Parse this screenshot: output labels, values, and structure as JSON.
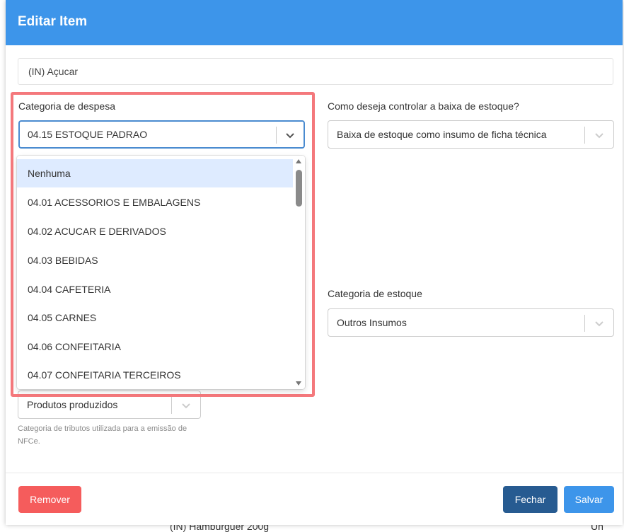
{
  "modal": {
    "title": "Editar Item",
    "item_name": "(IN) Açucar"
  },
  "expense_category": {
    "label": "Categoria de despesa",
    "selected": "04.15 ESTOQUE PADRAO",
    "options": [
      "Nenhuma",
      "04.01 ACESSORIOS E EMBALAGENS",
      "04.02 ACUCAR E DERIVADOS",
      "04.03 BEBIDAS",
      "04.04 CAFETERIA",
      "04.05 CARNES",
      "04.06 CONFEITARIA",
      "04.07 CONFEITARIA TERCEIROS"
    ],
    "highlighted_option": "Nenhuma"
  },
  "stock_control": {
    "label": "Como deseja controlar a baixa de estoque?",
    "selected": "Baixa de estoque como insumo de ficha técnica"
  },
  "stock_category": {
    "label": "Categoria de estoque",
    "selected": "Outros Insumos"
  },
  "tax_category": {
    "selected": "Produtos produzidos",
    "helper": "Categoria de tributos utilizada para a emissão de NFCe."
  },
  "buttons": {
    "remove": "Remover",
    "close": "Fechar",
    "save": "Salvar"
  },
  "background": {
    "row_text": "(IN) Hamburguer 200g",
    "row_unit": "Un"
  },
  "colors": {
    "header": "#3d95ea",
    "highlight_border": "#f4787c",
    "remove": "#f55c5c",
    "close": "#275b91",
    "save": "#3d95ea"
  },
  "icons": {
    "chevron": "chevron-down-icon",
    "scroll_up": "scroll-up-arrow-icon",
    "scroll_down": "scroll-down-arrow-icon"
  }
}
